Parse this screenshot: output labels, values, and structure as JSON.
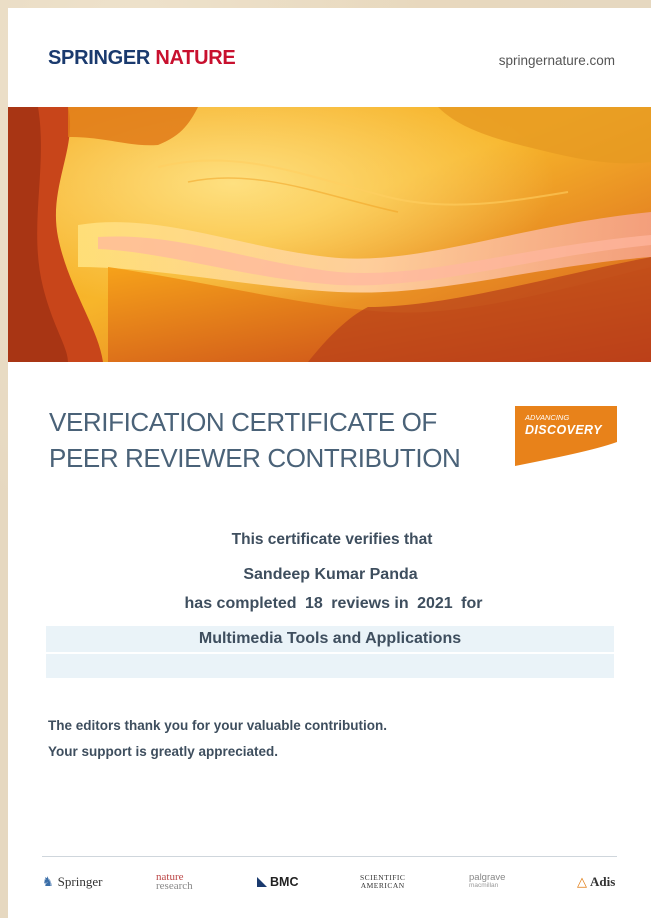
{
  "header": {
    "brand_part1": "SPRINGER",
    "brand_part2": "NATURE",
    "site_url": "springernature.com"
  },
  "certificate": {
    "title_line1": "VERIFICATION CERTIFICATE OF",
    "title_line2": "PEER REVIEWER CONTRIBUTION",
    "badge_small": "ADVANCING",
    "badge_big": "DISCOVERY",
    "verifies_text": "This certificate verifies that",
    "reviewer_name": "Sandeep Kumar Panda",
    "completed_prefix": "has completed",
    "review_count": "18",
    "reviews_in": "reviews in",
    "year": "2021",
    "for_word": "for",
    "journal": "Multimedia Tools and Applications",
    "thanks_line1": "The editors thank you for your valuable contribution.",
    "thanks_line2": "Your support is greatly appreciated."
  },
  "footer": {
    "logos": {
      "springer": "Springer",
      "nature_line1": "nature",
      "nature_line2": "research",
      "bmc": "BMC",
      "sa_line1": "SCIENTIFIC",
      "sa_line2": "AMERICAN",
      "palgrave_line1": "palgrave",
      "palgrave_line2": "macmillan",
      "adis": "Adis"
    }
  },
  "colors": {
    "brand_navy": "#1a3a6e",
    "brand_red": "#c8102e",
    "title_blue": "#4a6278",
    "badge_orange": "#e8821a",
    "box_blue": "#eaf3f8"
  }
}
